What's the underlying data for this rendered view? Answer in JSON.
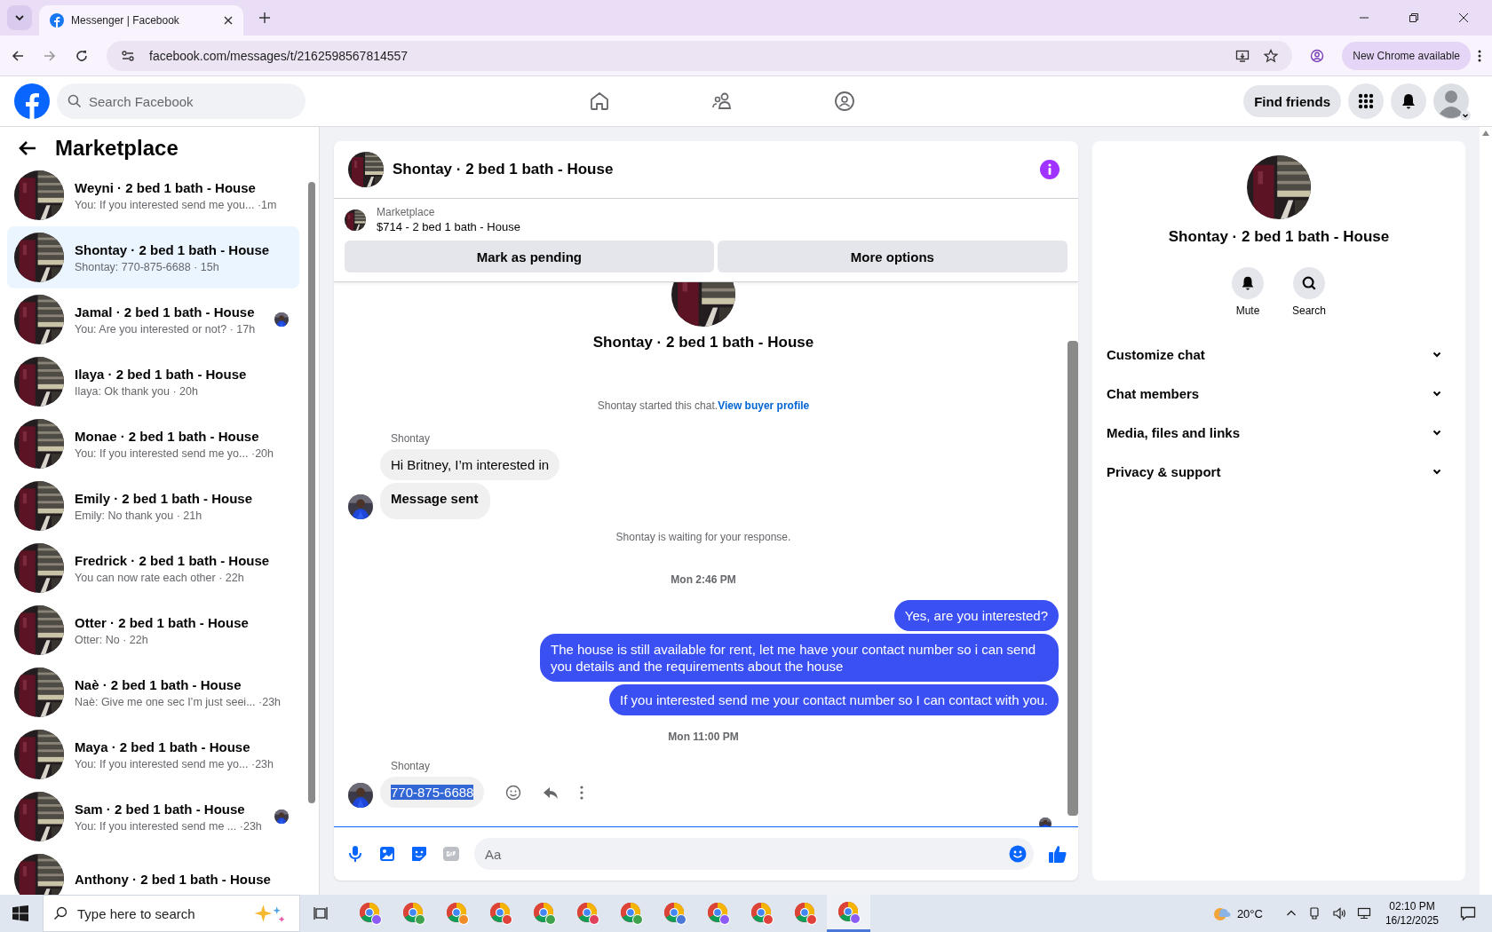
{
  "browser": {
    "tab_title": "Messenger | Facebook",
    "url": "facebook.com/messages/t/2162598567814557",
    "update_label": "New Chrome available"
  },
  "header": {
    "search_placeholder": "Search Facebook",
    "find_friends": "Find friends"
  },
  "sidebar": {
    "title": "Marketplace",
    "conversations": [
      {
        "title": "Weyni · 2 bed 1 bath - House",
        "meta": "You: If you interested send me you... ·1m",
        "selected": false,
        "seen_avatar": false
      },
      {
        "title": "Shontay · 2 bed 1 bath - House",
        "meta": "Shontay: 770-875-6688 · 15h",
        "selected": true,
        "seen_avatar": false
      },
      {
        "title": "Jamal · 2 bed 1 bath - House",
        "meta": "You: Are you interested or not? · 17h",
        "selected": false,
        "seen_avatar": true
      },
      {
        "title": "Ilaya · 2 bed 1 bath - House",
        "meta": "Ilaya: Ok thank you · 20h",
        "selected": false,
        "seen_avatar": false
      },
      {
        "title": "Monae · 2 bed 1 bath - House",
        "meta": "You: If you interested send me yo...  ·20h",
        "selected": false,
        "seen_avatar": false
      },
      {
        "title": "Emily · 2 bed 1 bath - House",
        "meta": "Emily: No thank you · 21h",
        "selected": false,
        "seen_avatar": false
      },
      {
        "title": "Fredrick · 2 bed 1 bath - House",
        "meta": "You can now rate each other · 22h",
        "selected": false,
        "seen_avatar": false
      },
      {
        "title": "Otter · 2 bed 1 bath - House",
        "meta": "Otter: No · 22h",
        "selected": false,
        "seen_avatar": false
      },
      {
        "title": "Naè · 2 bed 1 bath - House",
        "meta": "Naè: Give me one sec I’m just seei... ·23h",
        "selected": false,
        "seen_avatar": false
      },
      {
        "title": "Maya · 2 bed 1 bath - House",
        "meta": "You: If you interested send me yo...  ·23h",
        "selected": false,
        "seen_avatar": false
      },
      {
        "title": "Sam · 2 bed 1 bath - House",
        "meta": "You: If you interested send me ...  ·23h",
        "selected": false,
        "seen_avatar": true
      },
      {
        "title": "Anthony · 2 bed 1 bath - House",
        "selected": false,
        "seen_avatar": false
      }
    ]
  },
  "chat": {
    "title": "Shontay · 2 bed 1 bath - House",
    "listing": {
      "source": "Marketplace",
      "summary": "$714 - 2 bed 1 bath - House"
    },
    "actions": [
      "Mark as pending",
      "More options"
    ],
    "intro_title": "Shontay · 2 bed 1 bath - House",
    "messages": [
      {
        "kind": "note",
        "text": "Shontay started this chat.",
        "link": "View buyer profile"
      },
      {
        "kind": "sender",
        "text": "Shontay"
      },
      {
        "kind": "incoming",
        "text": "Hi Britney, I’m interested in",
        "avatar": false,
        "bold": false,
        "highlighted": false,
        "tools": false
      },
      {
        "kind": "incoming",
        "text": "Message sent",
        "avatar": true,
        "bold": true,
        "highlighted": false,
        "tools": false
      },
      {
        "kind": "note",
        "text": "Shontay is waiting for your response."
      },
      {
        "kind": "timestamp",
        "text": "Mon 2:46 PM"
      },
      {
        "kind": "outgoing",
        "text": "Yes, are you interested?"
      },
      {
        "kind": "outgoing",
        "text": "The house is still available for rent, let me have your contact number so i can send you details and the requirements about the house"
      },
      {
        "kind": "outgoing",
        "text": "If you interested send me your contact number so I can contact with you."
      },
      {
        "kind": "timestamp",
        "text": "Mon 11:00 PM"
      },
      {
        "kind": "sender",
        "text": "Shontay"
      },
      {
        "kind": "incoming",
        "text": "770-875-6688",
        "avatar": true,
        "bold": false,
        "highlighted": true,
        "tools": true
      }
    ],
    "composer_placeholder": "Aa"
  },
  "details": {
    "title": "Shontay · 2 bed 1 bath - House",
    "actions": [
      {
        "label": "Mute"
      },
      {
        "label": "Search"
      }
    ],
    "sections": [
      "Customize chat",
      "Chat members",
      "Media, files and links",
      "Privacy & support"
    ]
  },
  "taskbar": {
    "search_placeholder": "Type here to search",
    "apps": [
      {
        "color": "#8b5cf6",
        "selected": false
      },
      {
        "color": "#3fa34d",
        "selected": false
      },
      {
        "color": "#f08c28",
        "selected": false
      },
      {
        "color": "#e0413a",
        "selected": false
      },
      {
        "color": "#3fa34d",
        "selected": false
      },
      {
        "color": "#e0415a",
        "selected": false
      },
      {
        "color": "#3fa34d",
        "selected": false
      },
      {
        "color": "#4a78d8",
        "selected": false
      },
      {
        "color": "#8b5cf6",
        "selected": false
      },
      {
        "color": "#e0413a",
        "selected": false
      },
      {
        "color": "#e0413a",
        "selected": false
      },
      {
        "color": "#8b5cf6",
        "selected": true
      }
    ],
    "weather": "20°C",
    "time": "02:10 PM",
    "date": "16/12/2025"
  }
}
